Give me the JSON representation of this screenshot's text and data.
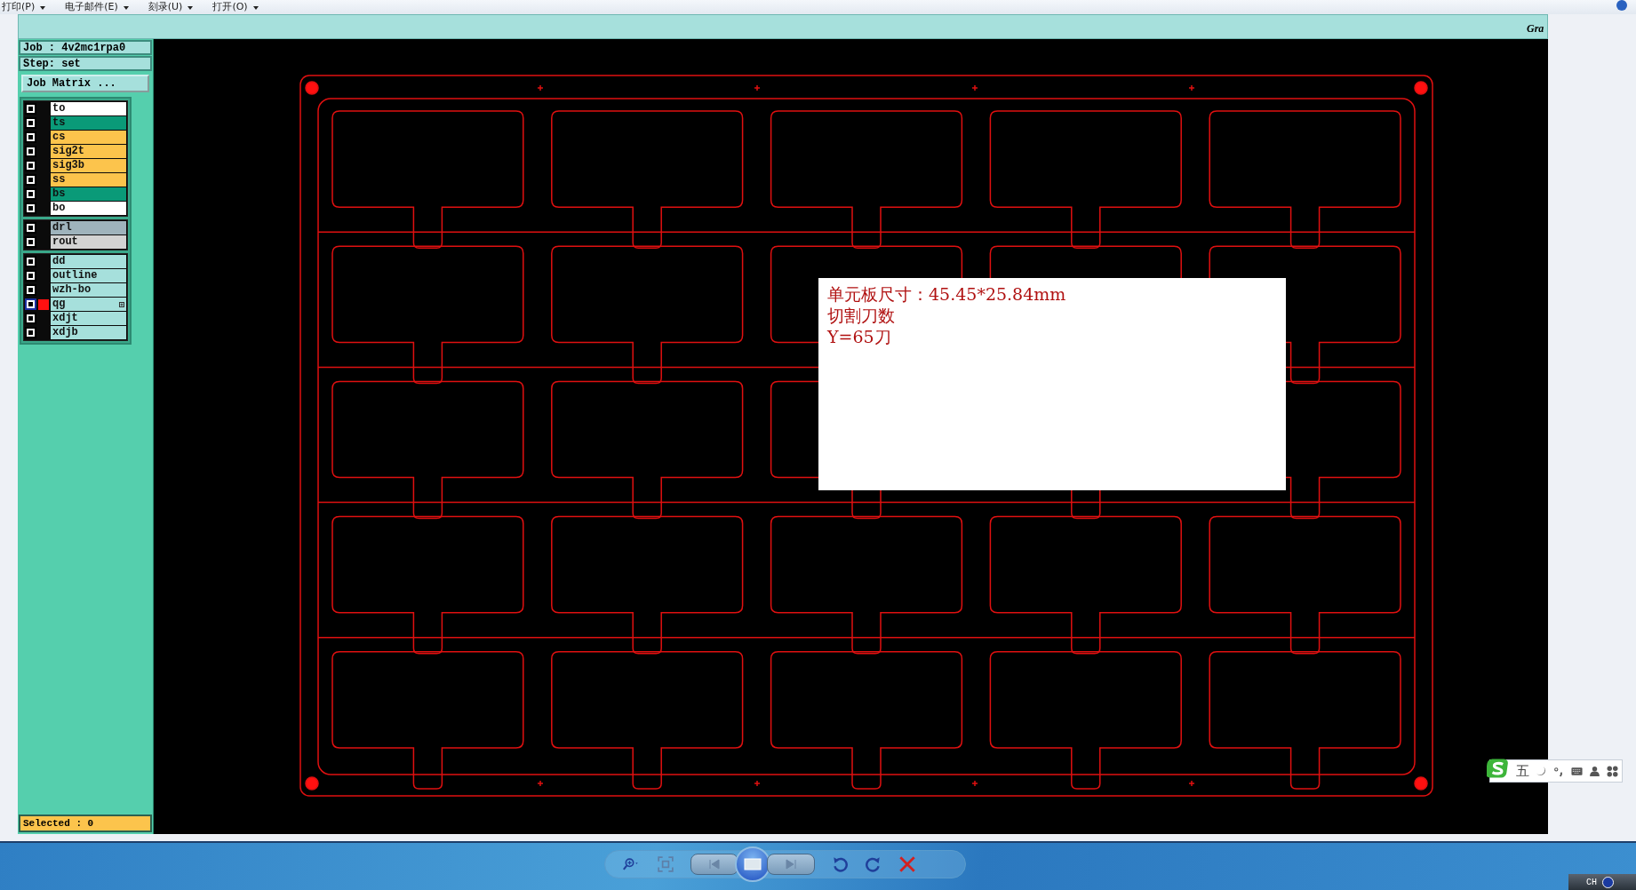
{
  "menu": [
    {
      "label": "打印(P)"
    },
    {
      "label": "电子邮件(E)"
    },
    {
      "label": "刻录(U)"
    },
    {
      "label": "打开(O)"
    }
  ],
  "header": {
    "logo_text": "Gra"
  },
  "job": "Job : 4v2mc1rpa0",
  "step": "Step: set",
  "job_matrix_button": "Job Matrix ...",
  "layer_groups": [
    [
      {
        "name": "to",
        "color": "#ffffff",
        "checked": false,
        "active": false
      },
      {
        "name": "ts",
        "color": "#0a9a78",
        "checked": false,
        "active": false
      },
      {
        "name": "cs",
        "color": "#fcc44c",
        "checked": false,
        "active": false
      },
      {
        "name": "sig2t",
        "color": "#fcc44c",
        "checked": false,
        "active": false
      },
      {
        "name": "sig3b",
        "color": "#fcc44c",
        "checked": false,
        "active": false
      },
      {
        "name": "ss",
        "color": "#fcc44c",
        "checked": false,
        "active": false
      },
      {
        "name": "bs",
        "color": "#0a9a78",
        "checked": false,
        "active": false
      },
      {
        "name": "bo",
        "color": "#ffffff",
        "checked": false,
        "active": false
      }
    ],
    [
      {
        "name": "drl",
        "color": "#9fb3bc",
        "checked": false,
        "active": false
      },
      {
        "name": "rout",
        "color": "#d3d3d3",
        "checked": false,
        "active": false
      }
    ],
    [
      {
        "name": "dd",
        "color": "#a6e0dc",
        "checked": false,
        "active": false
      },
      {
        "name": "outline",
        "color": "#a6e0dc",
        "checked": false,
        "active": false
      },
      {
        "name": "wzh-bo",
        "color": "#a6e0dc",
        "checked": false,
        "active": false
      },
      {
        "name": "qg",
        "color": "#a6e0dc",
        "checked": false,
        "active": true
      },
      {
        "name": "xdjt",
        "color": "#a6e0dc",
        "checked": false,
        "active": false
      },
      {
        "name": "xdjb",
        "color": "#a6e0dc",
        "checked": false,
        "active": false
      }
    ]
  ],
  "selected_count": "Selected : 0",
  "note": {
    "lines": [
      "单元板尺寸：45.45*25.84mm",
      "切割刀数",
      "Y=65刀"
    ]
  },
  "ime": {
    "mode": "五"
  },
  "taskbar": {
    "language": "CH"
  }
}
